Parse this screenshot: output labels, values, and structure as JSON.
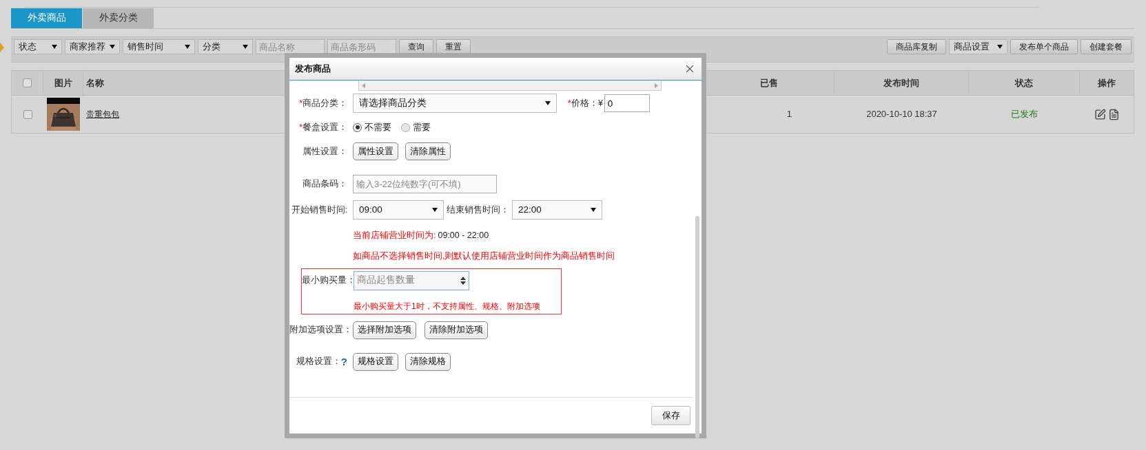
{
  "tabs": [
    {
      "label": "外卖商品",
      "selected": true
    },
    {
      "label": "外卖分类",
      "selected": false
    }
  ],
  "toolbar": {
    "filters": [
      {
        "kind": "select",
        "label": "状态"
      },
      {
        "kind": "select",
        "label": "商家推荐"
      },
      {
        "kind": "select",
        "label": "销售时间"
      },
      {
        "kind": "select",
        "label": "分类"
      },
      {
        "kind": "input",
        "placeholder": "商品名称"
      },
      {
        "kind": "input",
        "placeholder": "商品条形码"
      },
      {
        "kind": "button",
        "label": "查询"
      },
      {
        "kind": "button",
        "label": "重置"
      }
    ],
    "actions": [
      {
        "kind": "button",
        "label": "商品库复制"
      },
      {
        "kind": "select",
        "label": "商品设置"
      },
      {
        "kind": "button",
        "label": "发布单个商品"
      },
      {
        "kind": "button",
        "label": "创建套餐"
      }
    ]
  },
  "table": {
    "header_checked": false,
    "columns": [
      "图片",
      "名称",
      "已售",
      "发布时间",
      "状态",
      "操作"
    ],
    "rows": [
      {
        "checked": false,
        "name": "贵重包包",
        "sold": "1",
        "published": "2020-10-10 18:37",
        "status": "已发布"
      }
    ]
  },
  "dialog": {
    "title": "发布商品",
    "category": {
      "mark": "*",
      "label": "商品分类：",
      "value": "请选择商品分类"
    },
    "price": {
      "mark": "*",
      "label": "价格：¥",
      "value": "0"
    },
    "box_setting": {
      "mark": "*",
      "label": "餐盒设置：",
      "options": [
        {
          "label": "不需要",
          "selected": true
        },
        {
          "label": "需要",
          "selected": false
        }
      ]
    },
    "attributes": {
      "label": "属性设置：",
      "buttons": [
        "属性设置",
        "清除属性"
      ]
    },
    "barcode": {
      "label": "商品条码：",
      "placeholder": "输入3-22位纯数字(可不填)"
    },
    "sale_start": {
      "label": "开始销售时间:",
      "value": "09:00"
    },
    "sale_end": {
      "label": "结束销售时间：",
      "value": "22:00"
    },
    "business_hours": {
      "label": "当前店铺营业时间为:",
      "value": "09:00 - 22:00"
    },
    "sale_time_note": "如商品不选择销售时间,则默认使用店铺营业时间作为商品销售时间",
    "min_purchase": {
      "label": "最小购买量：",
      "placeholder": "商品起售数量",
      "note": "最小购买量大于1时，不支持属性、规格、附加选项"
    },
    "addons": {
      "label": "附加选项设置：",
      "buttons": [
        "选择附加选项",
        "清除附加选项"
      ]
    },
    "specs": {
      "label": "规格设置：",
      "help": "?",
      "buttons": [
        "规格设置",
        "清除规格"
      ]
    },
    "save": "保存"
  }
}
